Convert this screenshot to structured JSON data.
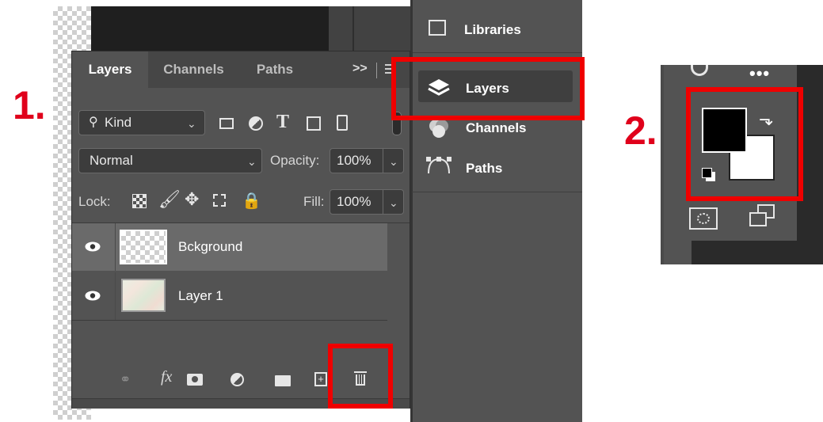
{
  "annotations": {
    "step1": "1.",
    "step2": "2."
  },
  "layers_panel": {
    "tabs": [
      "Layers",
      "Channels",
      "Paths"
    ],
    "menu_glyph": ">>",
    "filter": {
      "kind_label": "Kind"
    },
    "blend_mode": "Normal",
    "opacity_label": "Opacity:",
    "opacity_value": "100%",
    "lock_label": "Lock:",
    "fill_label": "Fill:",
    "fill_value": "100%",
    "layers": [
      {
        "name": "Bckground",
        "selected": true
      },
      {
        "name": "Layer 1",
        "selected": false
      }
    ],
    "fx_label": "fx"
  },
  "side_panel": {
    "items": [
      "Libraries",
      "Layers",
      "Channels",
      "Paths"
    ]
  },
  "colors": {
    "panel": "#535353",
    "highlight": "#ef0000",
    "step_text": "#e0001b"
  },
  "icons": {
    "foreground_color": "#000000",
    "background_color": "#ffffff"
  }
}
